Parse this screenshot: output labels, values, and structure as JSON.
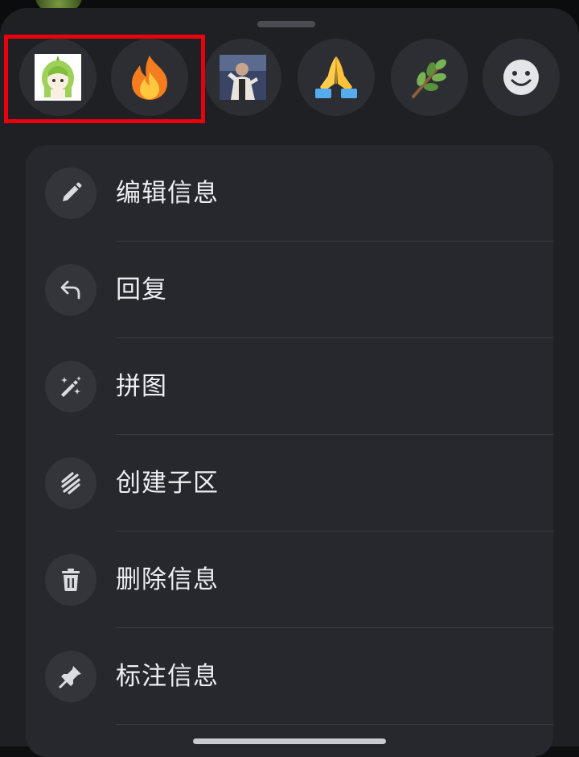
{
  "reactions": [
    {
      "name": "custom-anime-girl-emoji",
      "kind": "image"
    },
    {
      "name": "fire-emoji",
      "kind": "emoji"
    },
    {
      "name": "custom-person-photo-emoji",
      "kind": "image"
    },
    {
      "name": "folded-hands-emoji",
      "kind": "emoji"
    },
    {
      "name": "herb-emoji",
      "kind": "emoji"
    },
    {
      "name": "add-reaction-smiley",
      "kind": "icon"
    }
  ],
  "highlight_color": "#e8000c",
  "menu": {
    "items": [
      {
        "label": "编辑信息",
        "icon": "pencil-icon"
      },
      {
        "label": "回复",
        "icon": "reply-arrow-icon"
      },
      {
        "label": "拼图",
        "icon": "magic-wand-icon"
      },
      {
        "label": "创建子区",
        "icon": "thread-icon"
      },
      {
        "label": "删除信息",
        "icon": "trash-icon"
      },
      {
        "label": "标注信息",
        "icon": "pin-icon"
      }
    ]
  },
  "colors": {
    "sheet_bg": "#1f2024",
    "card_bg": "#27282d",
    "icon_bg": "#33353a",
    "text": "#eceef1",
    "icon": "#dadce0"
  }
}
